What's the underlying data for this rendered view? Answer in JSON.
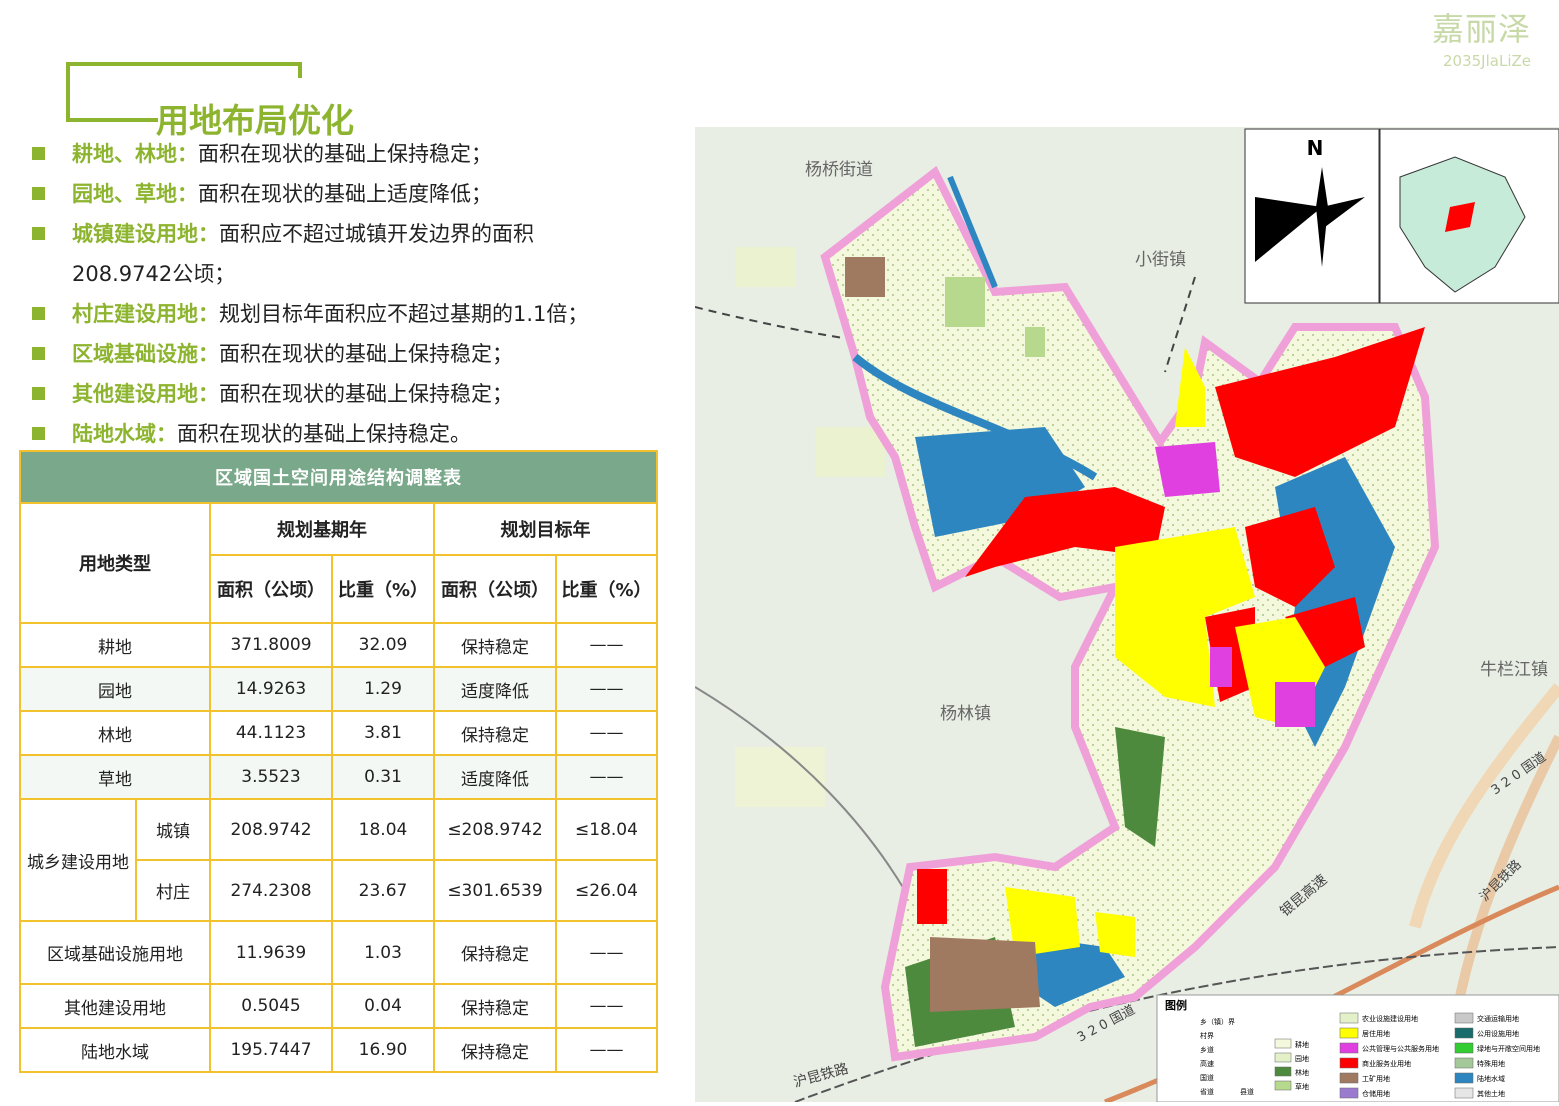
{
  "brand": {
    "cn": "嘉丽泽",
    "en": "2035JlaLiZe"
  },
  "title": "用地布局优化",
  "bullets": [
    {
      "key": "耕地、林地：",
      "text": "面积在现状的基础上保持稳定；"
    },
    {
      "key": "园地、草地：",
      "text": "面积在现状的基础上适度降低；"
    },
    {
      "key": "城镇建设用地：",
      "text": "面积应不超过城镇开发边界的面积",
      "cont": "208.9742公顷；"
    },
    {
      "key": "村庄建设用地：",
      "text": "规划目标年面积应不超过基期的1.1倍；"
    },
    {
      "key": "区域基础设施：",
      "text": "面积在现状的基础上保持稳定；"
    },
    {
      "key": "其他建设用地：",
      "text": "面积在现状的基础上保持稳定；"
    },
    {
      "key": "陆地水域：",
      "text": "面积在现状的基础上保持稳定。"
    }
  ],
  "table": {
    "caption": "区域国土空间用途结构调整表",
    "col_type": "用地类型",
    "col_base": "规划基期年",
    "col_target": "规划目标年",
    "col_area": "面积（公顷）",
    "col_ratio": "比重（%）",
    "rows": [
      {
        "type": "耕地",
        "base_area": "371.8009",
        "base_ratio": "32.09",
        "target_area": "保持稳定",
        "target_ratio": "——"
      },
      {
        "type": "园地",
        "base_area": "14.9263",
        "base_ratio": "1.29",
        "target_area": "适度降低",
        "target_ratio": "——"
      },
      {
        "type": "林地",
        "base_area": "44.1123",
        "base_ratio": "3.81",
        "target_area": "保持稳定",
        "target_ratio": "——"
      },
      {
        "type": "草地",
        "base_area": "3.5523",
        "base_ratio": "0.31",
        "target_area": "适度降低",
        "target_ratio": "——"
      }
    ],
    "urban_rural": {
      "group": "城乡建设用地",
      "rows": [
        {
          "sub": "城镇",
          "base_area": "208.9742",
          "base_ratio": "18.04",
          "target_area": "≤208.9742",
          "target_ratio": "≤18.04"
        },
        {
          "sub": "村庄",
          "base_area": "274.2308",
          "base_ratio": "23.67",
          "target_area": "≤301.6539",
          "target_ratio": "≤26.04"
        }
      ]
    },
    "rows_after": [
      {
        "type": "区域基础设施用地",
        "base_area": "11.9639",
        "base_ratio": "1.03",
        "target_area": "保持稳定",
        "target_ratio": "——"
      },
      {
        "type": "其他建设用地",
        "base_area": "0.5045",
        "base_ratio": "0.04",
        "target_area": "保持稳定",
        "target_ratio": "——"
      },
      {
        "type": "陆地水域",
        "base_area": "195.7447",
        "base_ratio": "16.90",
        "target_area": "保持稳定",
        "target_ratio": "——"
      }
    ]
  },
  "map": {
    "place_labels": [
      "杨桥街道",
      "小街镇",
      "杨林镇",
      "牛栏江镇"
    ],
    "road_labels": [
      "银昆高速",
      "沪昆铁路",
      "3 2 0 国道",
      "3 2 0 国道",
      "沪昆铁路"
    ],
    "north": "N",
    "legend_title": "图例",
    "legend_items": [
      "农业设施建设用地",
      "居住用地",
      "公共管理与公共服务用地",
      "商业服务业用地",
      "工矿用地",
      "仓储用地",
      "交通运输用地",
      "公用设施用地",
      "绿地与开敞空间用地",
      "特殊用地",
      "陆地水域",
      "其他土地",
      "耕地",
      "园地",
      "林地",
      "草地"
    ],
    "legend_line_items": [
      "乡（镇）界",
      "村界",
      "乡道",
      "高速",
      "国道",
      "省道",
      "县道"
    ],
    "colors": {
      "residential": "#ffff00",
      "commercial": "#ff0000",
      "public": "#e040e0",
      "water": "#2e86c1",
      "farmland": "#f4f8dc",
      "forest": "#4e8a3e",
      "boundary": "#f0a0d8"
    }
  }
}
